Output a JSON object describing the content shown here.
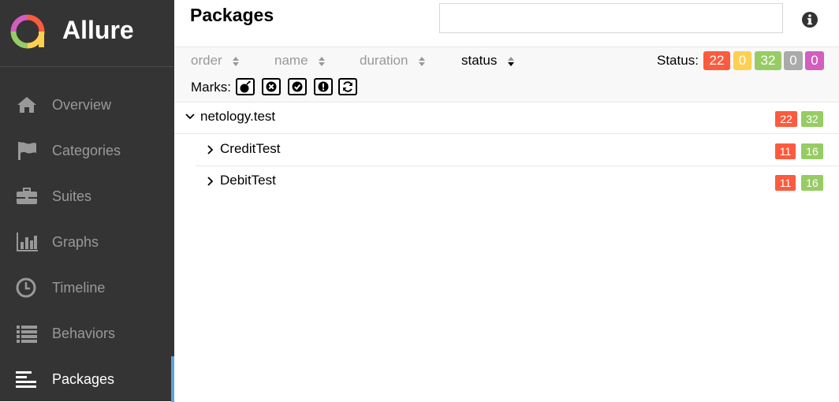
{
  "app": {
    "name": "Allure"
  },
  "sidebar": {
    "items": [
      {
        "label": "Overview",
        "icon": "home-icon"
      },
      {
        "label": "Categories",
        "icon": "flag-icon"
      },
      {
        "label": "Suites",
        "icon": "briefcase-icon"
      },
      {
        "label": "Graphs",
        "icon": "bar-chart-icon"
      },
      {
        "label": "Timeline",
        "icon": "clock-icon"
      },
      {
        "label": "Behaviors",
        "icon": "list-icon"
      },
      {
        "label": "Packages",
        "icon": "align-left-icon",
        "active": true
      }
    ]
  },
  "page": {
    "title": "Packages",
    "search_value": ""
  },
  "sort": {
    "order": "order",
    "name": "name",
    "duration": "duration",
    "status": "status"
  },
  "status_summary": {
    "label": "Status:",
    "failed": "22",
    "broken": "0",
    "passed": "32",
    "skipped": "0",
    "unknown": "0"
  },
  "marks": {
    "label": "Marks:"
  },
  "colors": {
    "failed": "#fd5a3e",
    "broken": "#ffd050",
    "passed": "#97cc64",
    "skipped": "#aaaaaa",
    "unknown": "#d35ebe",
    "sidebar_bg": "#343434",
    "accent": "#5aa3df"
  },
  "tree": {
    "root": {
      "name": "netology.test",
      "failed": "22",
      "passed": "32",
      "expanded": true
    },
    "children": [
      {
        "name": "CreditTest",
        "failed": "11",
        "passed": "16",
        "expanded": false
      },
      {
        "name": "DebitTest",
        "failed": "11",
        "passed": "16",
        "expanded": false
      }
    ]
  }
}
